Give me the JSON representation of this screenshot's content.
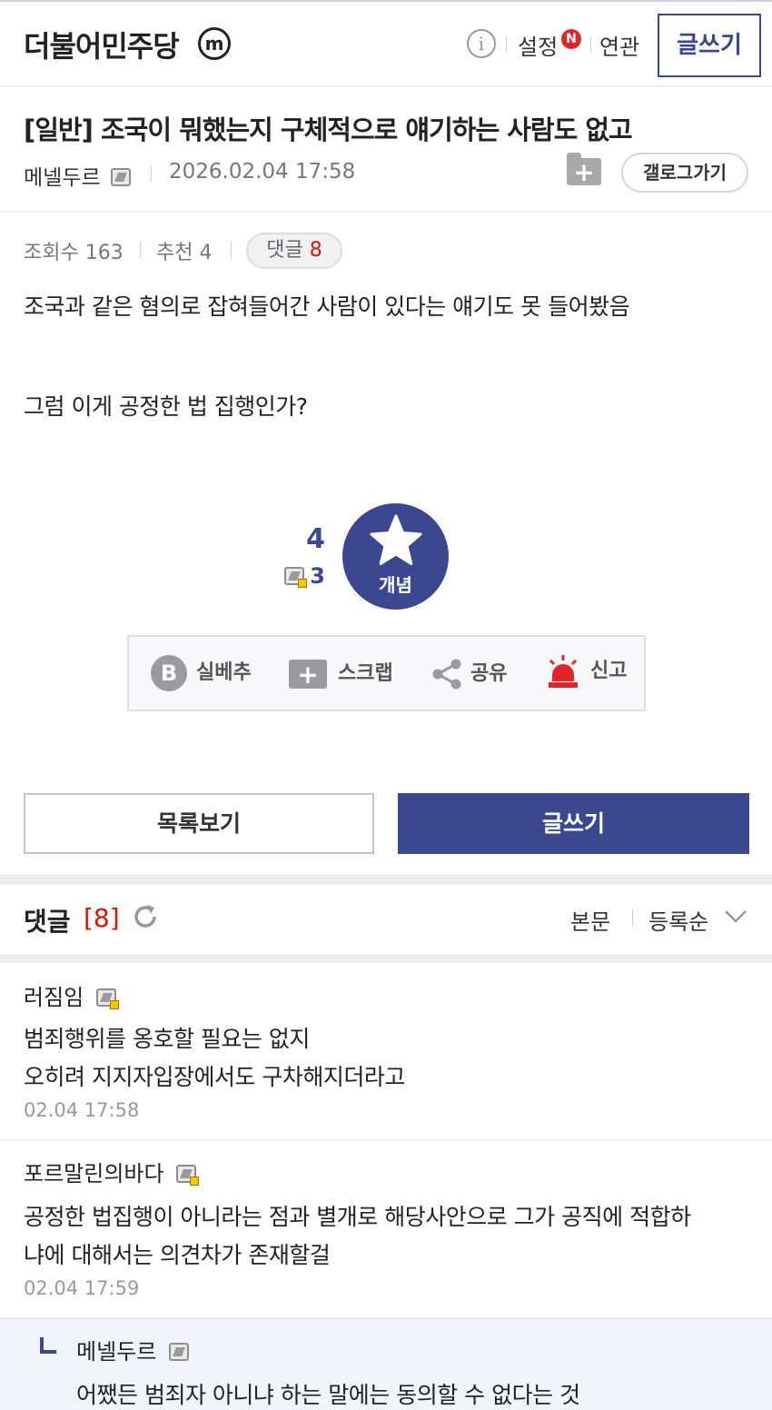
{
  "header": {
    "gallery_name": "더불어민주당",
    "minor_badge": "m",
    "info_icon": "i",
    "settings_label": "설정",
    "new_badge": "N",
    "related_label": "연관",
    "write_label": "글쓰기"
  },
  "post": {
    "title": "[일반] 조국이 뭐했는지 구체적으로 얘기하는 사람도 없고",
    "author": "메넬두르",
    "date": "2026.02.04 17:58",
    "gallery_button": "갤로그가기",
    "views": "조회수 163",
    "recommends_label": "추천 4",
    "comments_pill_label": "댓글",
    "comments_pill_count": "8",
    "body": [
      "조국과 같은 혐의로 잡혀들어간 사람이 있다는 얘기도 못 들어봤음",
      "그럼 이게 공정한 법 집행인가?"
    ]
  },
  "recommend": {
    "count": "4",
    "fixed_count": "3",
    "button_label": "개념"
  },
  "actions": {
    "silbe_label": "실베추",
    "silbe_icon_letter": "B",
    "scrap_label": "스크랩",
    "share_label": "공유",
    "report_label": "신고"
  },
  "bottom_buttons": {
    "list_label": "목록보기",
    "write_label": "글쓰기"
  },
  "comments_header": {
    "title": "댓글",
    "count": "[8]",
    "tab_body": "본문",
    "tab_sort": "등록순"
  },
  "comments": [
    {
      "name": "러짐임",
      "lines": [
        "범죄행위를 옹호할 필요는 없지",
        "오히려 지지자입장에서도 구차해지더라고"
      ],
      "date": "02.04 17:58"
    },
    {
      "name": "포르말린의바다",
      "lines": [
        "공정한 법집행이 아니라는 점과 별개로 해당사안으로 그가 공직에 적합하",
        "냐에 대해서는 의견차가 존재할걸"
      ],
      "date": "02.04 17:59"
    }
  ],
  "reply": {
    "name": "메넬두르",
    "text": "어쨌든 범죄자 아니냐 하는 말에는 동의할 수 없다는 것"
  },
  "colors": {
    "accent": "#3b4890",
    "alert": "#d31900",
    "report_red": "#e0242a"
  },
  "icons": [
    "info-icon",
    "fixed-member-icon",
    "scrap-icon",
    "star-icon",
    "share-icon",
    "siren-icon",
    "refresh-icon",
    "chevron-down-icon"
  ]
}
